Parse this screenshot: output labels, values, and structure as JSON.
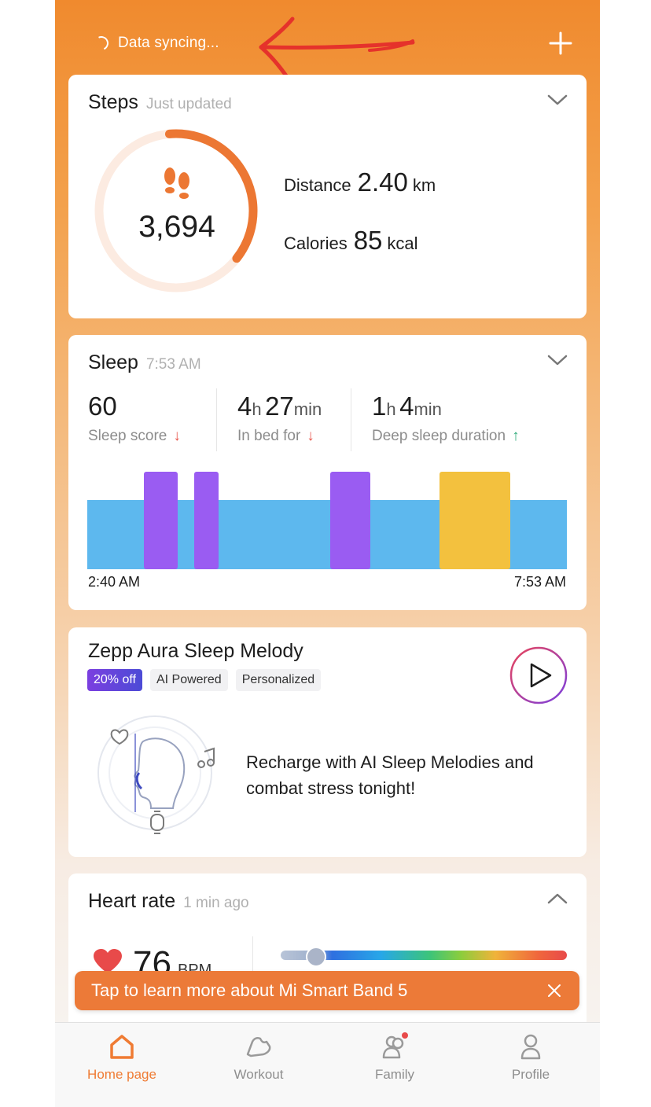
{
  "header": {
    "sync_text": "Data syncing...",
    "add_icon": "plus-icon"
  },
  "steps": {
    "title": "Steps",
    "subtitle": "Just updated",
    "count": "3,694",
    "goal_progress": 0.37,
    "distance_label": "Distance",
    "distance_value": "2.40",
    "distance_unit": "km",
    "calories_label": "Calories",
    "calories_value": "85",
    "calories_unit": "kcal"
  },
  "sleep": {
    "title": "Sleep",
    "subtitle": "7:53 AM",
    "score_value": "60",
    "score_label": "Sleep score",
    "bed_h": "4",
    "bed_h_unit": "h",
    "bed_m": "27",
    "bed_m_unit": "min",
    "bed_label": "In bed for",
    "deep_h": "1",
    "deep_h_unit": "h",
    "deep_m": "4",
    "deep_m_unit": "min",
    "deep_label": "Deep sleep duration",
    "start_time": "2:40 AM",
    "end_time": "7:53 AM",
    "colors": {
      "light": "#5db8ee",
      "deep": "#9a5cf2",
      "awake": "#f3c13e",
      "down_arrow": "#e8554b",
      "up_arrow": "#2eaa7a"
    }
  },
  "zepp": {
    "title": "Zepp Aura Sleep Melody",
    "tags": [
      "20% off",
      "AI Powered",
      "Personalized"
    ],
    "description": "Recharge with AI Sleep Melodies and combat stress tonight!"
  },
  "heart_rate": {
    "title": "Heart rate",
    "subtitle": "1 min ago",
    "value": "76",
    "unit": "BPM"
  },
  "banner": {
    "text": "Tap to learn more about Mi Smart Band 5"
  },
  "tabs": [
    {
      "label": "Home page",
      "icon": "home-icon",
      "active": true
    },
    {
      "label": "Workout",
      "icon": "shoe-icon",
      "active": false
    },
    {
      "label": "Family",
      "icon": "family-icon",
      "active": false
    },
    {
      "label": "Profile",
      "icon": "profile-icon",
      "active": false
    }
  ],
  "accent": "#ef7b33"
}
